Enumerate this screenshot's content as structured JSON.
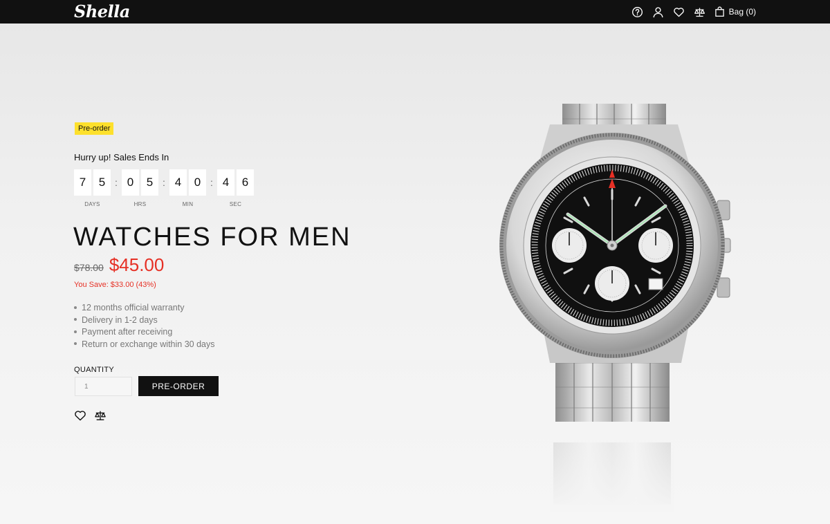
{
  "header": {
    "logo": "Shella",
    "icons": [
      "help-icon",
      "user-icon",
      "heart-icon",
      "compare-icon",
      "bag-icon"
    ],
    "bag_label": "Bag (0)"
  },
  "product": {
    "badge": "Pre-order",
    "countdown_title": "Hurry up! Sales Ends In",
    "countdown": {
      "days": [
        "7",
        "5"
      ],
      "hours": [
        "0",
        "5"
      ],
      "minutes": [
        "4",
        "0"
      ],
      "seconds": [
        "4",
        "6"
      ],
      "separator": ":",
      "labels": {
        "days": "DAYS",
        "hours": "HRS",
        "minutes": "MIN",
        "seconds": "SEC"
      }
    },
    "title": "WATCHES FOR MEN",
    "old_price": "$78.00",
    "price": "$45.00",
    "savings": "You Save: $33.00 (43%)",
    "features": [
      "12 months official warranty",
      "Delivery in 1-2 days",
      "Payment after receiving",
      "Return or exchange within 30 days"
    ],
    "quantity_label": "QUANTITY",
    "quantity_value": "1",
    "button_label": "PRE-ORDER"
  },
  "colors": {
    "header_bg": "#111111",
    "badge_bg": "#fde02c",
    "sale_price": "#e63025",
    "button_bg": "#111111"
  }
}
